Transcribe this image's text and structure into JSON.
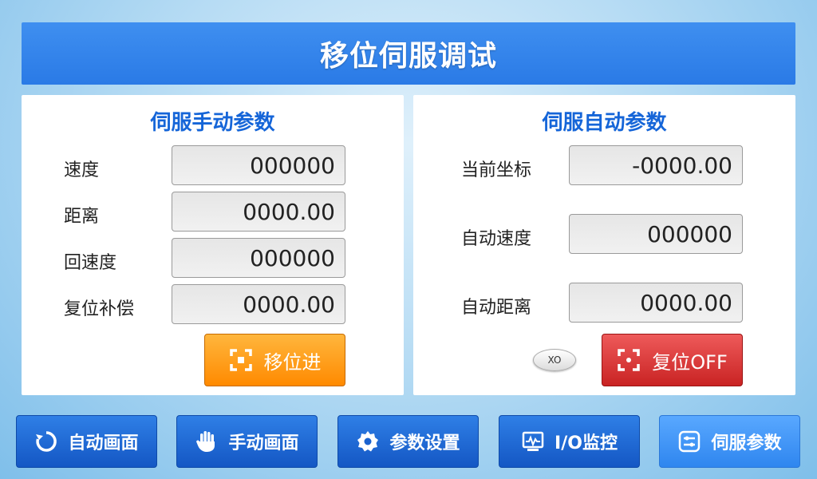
{
  "title": "移位伺服调试",
  "manual_panel": {
    "title": "伺服手动参数",
    "fields": [
      {
        "label": "速度",
        "value": "000000"
      },
      {
        "label": "距离",
        "value": "0000.00"
      },
      {
        "label": "回速度",
        "value": "000000"
      },
      {
        "label": "复位补偿",
        "value": "0000.00"
      }
    ],
    "move_button": "移位进"
  },
  "auto_panel": {
    "title": "伺服自动参数",
    "fields": [
      {
        "label": "当前坐标",
        "value": "-0000.00"
      },
      {
        "label": "自动速度",
        "value": "000000"
      },
      {
        "label": "自动距离",
        "value": "0000.00"
      }
    ],
    "indicator": "XO",
    "reset_button": "复位OFF"
  },
  "nav": {
    "items": [
      {
        "label": "自动画面",
        "icon": "refresh-icon"
      },
      {
        "label": "手动画面",
        "icon": "hand-icon"
      },
      {
        "label": "参数设置",
        "icon": "gear-icon"
      },
      {
        "label": "I/O监控",
        "icon": "monitor-icon"
      },
      {
        "label": "伺服参数",
        "icon": "sliders-icon"
      }
    ],
    "active_index": 4
  },
  "colors": {
    "title_bar": "#2a7ae6",
    "panel_title": "#1565d8",
    "move_button": "#ff8a00",
    "reset_button": "#c92323",
    "nav_button": "#1457c4",
    "nav_active": "#2f86ef"
  }
}
